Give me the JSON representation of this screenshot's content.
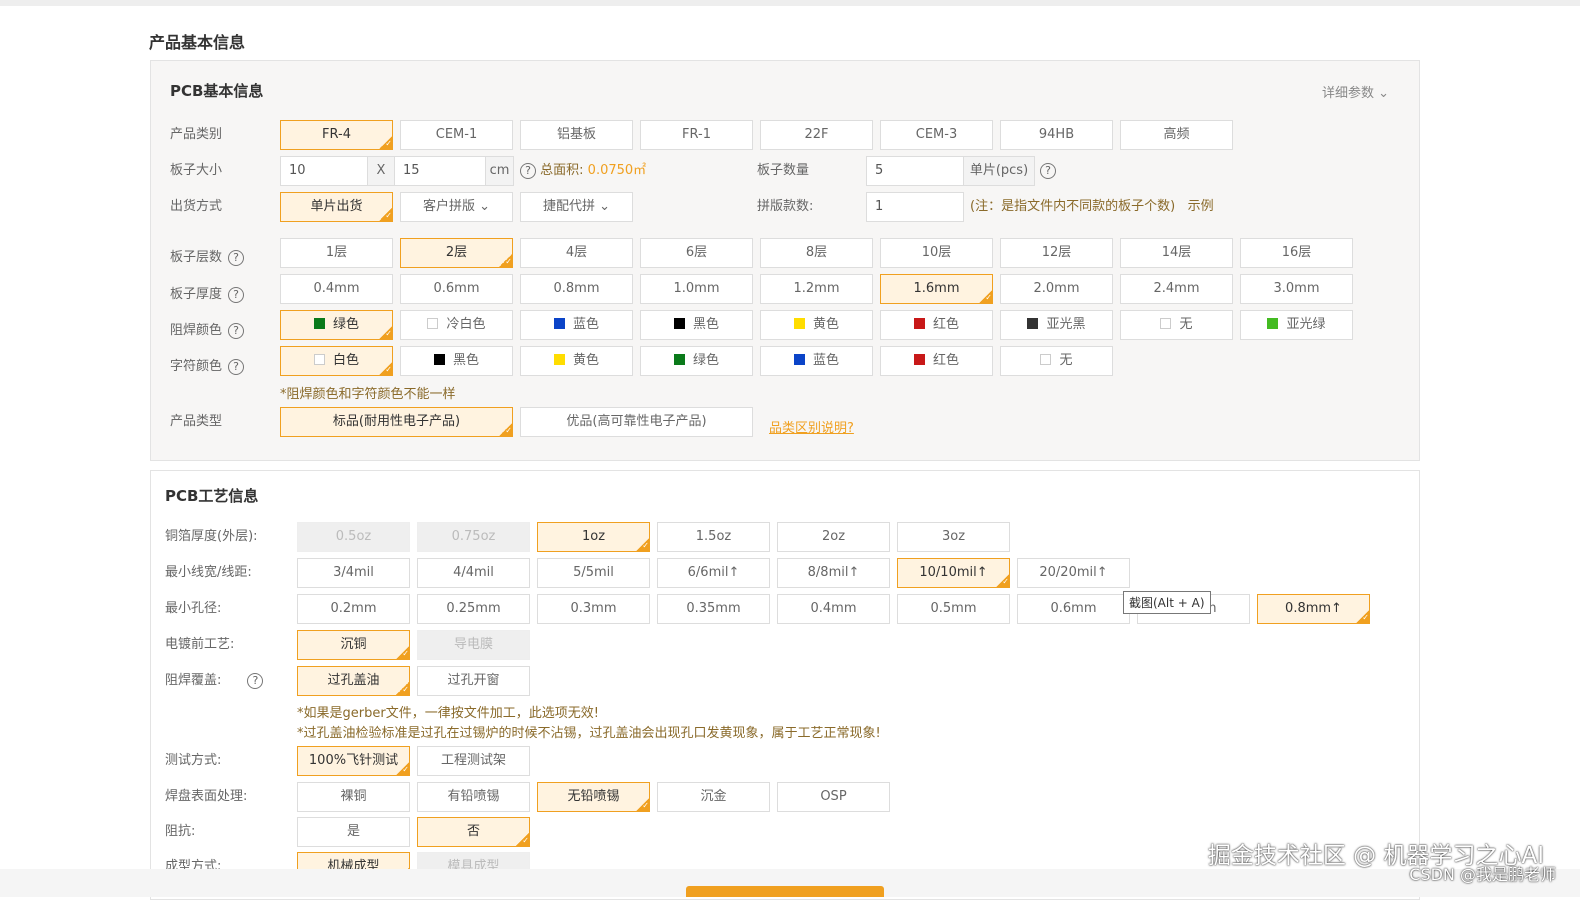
{
  "page_title": "产品基本信息",
  "basic": {
    "title": "PCB基本信息",
    "detail_label": "详细参数",
    "category": {
      "label": "产品类别",
      "options": [
        {
          "label": "FR-4",
          "sel": true
        },
        {
          "label": "CEM-1"
        },
        {
          "label": "铝基板"
        },
        {
          "label": "FR-1"
        },
        {
          "label": "22F"
        },
        {
          "label": "CEM-3"
        },
        {
          "label": "94HB"
        },
        {
          "label": "高频"
        }
      ]
    },
    "size": {
      "label": "板子大小",
      "width": "10",
      "x": "X",
      "height": "15",
      "unit": "cm",
      "area_label": "总面积:",
      "area_value": "0.0750㎡"
    },
    "quantity": {
      "label": "板子数量",
      "value": "5",
      "unit": "单片(pcs)"
    },
    "shipping": {
      "label": "出货方式",
      "options": [
        {
          "label": "单片出货",
          "sel": true
        },
        {
          "label": "客户拼版 ⌄"
        },
        {
          "label": "捷配代拼 ⌄"
        }
      ]
    },
    "panel_count": {
      "label": "拼版款数:",
      "value": "1",
      "note": "(注：是指文件内不同款的板子个数)",
      "example": "示例"
    },
    "layers": {
      "label": "板子层数",
      "options": [
        {
          "label": "1层"
        },
        {
          "label": "2层",
          "sel": true
        },
        {
          "label": "4层"
        },
        {
          "label": "6层"
        },
        {
          "label": "8层"
        },
        {
          "label": "10层"
        },
        {
          "label": "12层"
        },
        {
          "label": "14层"
        },
        {
          "label": "16层"
        }
      ]
    },
    "thickness": {
      "label": "板子厚度",
      "options": [
        {
          "label": "0.4mm"
        },
        {
          "label": "0.6mm"
        },
        {
          "label": "0.8mm"
        },
        {
          "label": "1.0mm"
        },
        {
          "label": "1.2mm"
        },
        {
          "label": "1.6mm",
          "sel": true
        },
        {
          "label": "2.0mm"
        },
        {
          "label": "2.4mm"
        },
        {
          "label": "3.0mm"
        }
      ]
    },
    "mask_color": {
      "label": "阻焊颜色",
      "options": [
        {
          "label": "绿色",
          "sel": true,
          "swatch": "#0a7a1a"
        },
        {
          "label": "冷白色",
          "swatch": "none"
        },
        {
          "label": "蓝色",
          "swatch": "#0b44c8"
        },
        {
          "label": "黑色",
          "swatch": "#000000"
        },
        {
          "label": "黄色",
          "swatch": "#ffdd00"
        },
        {
          "label": "红色",
          "swatch": "#c81818"
        },
        {
          "label": "亚光黑",
          "swatch": "#333333"
        },
        {
          "label": "无",
          "swatch": "none"
        },
        {
          "label": "亚光绿",
          "swatch": "#44bb22"
        }
      ]
    },
    "silk_color": {
      "label": "字符颜色",
      "options": [
        {
          "label": "白色",
          "sel": true,
          "swatch": "none"
        },
        {
          "label": "黑色",
          "swatch": "#000000"
        },
        {
          "label": "黄色",
          "swatch": "#ffdd00"
        },
        {
          "label": "绿色",
          "swatch": "#0a7a1a"
        },
        {
          "label": "蓝色",
          "swatch": "#0b44c8"
        },
        {
          "label": "红色",
          "swatch": "#c81818"
        },
        {
          "label": "无",
          "swatch": "none"
        }
      ]
    },
    "color_note": "*阻焊颜色和字符颜色不能一样",
    "product_type": {
      "label": "产品类型",
      "options": [
        {
          "label": "标品(耐用性电子产品)",
          "sel": true,
          "wide": true
        },
        {
          "label": "优品(高可靠性电子产品)",
          "wide": true
        }
      ],
      "link": "品类区别说明?"
    }
  },
  "process": {
    "title": "PCB工艺信息",
    "copper": {
      "label": "铜箔厚度(外层):",
      "options": [
        {
          "label": "0.5oz",
          "dis": true
        },
        {
          "label": "0.75oz",
          "dis": true
        },
        {
          "label": "1oz",
          "sel": true
        },
        {
          "label": "1.5oz"
        },
        {
          "label": "2oz"
        },
        {
          "label": "3oz"
        }
      ]
    },
    "trace": {
      "label": "最小线宽/线距:",
      "options": [
        {
          "label": "3/4mil"
        },
        {
          "label": "4/4mil"
        },
        {
          "label": "5/5mil"
        },
        {
          "label": "6/6mil↑"
        },
        {
          "label": "8/8mil↑"
        },
        {
          "label": "10/10mil↑",
          "sel": true
        },
        {
          "label": "20/20mil↑"
        }
      ]
    },
    "hole": {
      "label": "最小孔径:",
      "options": [
        {
          "label": "0.2mm"
        },
        {
          "label": "0.25mm"
        },
        {
          "label": "0.3mm"
        },
        {
          "label": "0.35mm"
        },
        {
          "label": "0.4mm"
        },
        {
          "label": "0.5mm"
        },
        {
          "label": "0.6mm"
        },
        {
          "label": "0.7mm"
        },
        {
          "label": "0.8mm↑",
          "sel": true
        }
      ]
    },
    "plating": {
      "label": "电镀前工艺:",
      "options": [
        {
          "label": "沉铜",
          "sel": true
        },
        {
          "label": "导电膜",
          "dis": true
        }
      ]
    },
    "via": {
      "label": "阻焊覆盖:",
      "options": [
        {
          "label": "过孔盖油",
          "sel": true
        },
        {
          "label": "过孔开窗"
        }
      ]
    },
    "via_notes": [
      "*如果是gerber文件，一律按文件加工，此选项无效!",
      "*过孔盖油检验标准是过孔在过锡炉的时候不沾锡，过孔盖油会出现孔口发黄现象，属于工艺正常现象!"
    ],
    "test": {
      "label": "测试方式:",
      "options": [
        {
          "label": "100%飞针测试",
          "sel": true
        },
        {
          "label": "工程测试架"
        }
      ]
    },
    "finish": {
      "label": "焊盘表面处理:",
      "options": [
        {
          "label": "裸铜"
        },
        {
          "label": "有铅喷锡"
        },
        {
          "label": "无铅喷锡",
          "sel": true
        },
        {
          "label": "沉金"
        },
        {
          "label": "OSP"
        }
      ]
    },
    "impedance": {
      "label": "阻抗:",
      "options": [
        {
          "label": "是"
        },
        {
          "label": "否",
          "sel": true
        }
      ]
    },
    "forming": {
      "label": "成型方式:",
      "options": [
        {
          "label": "机械成型",
          "sel": true
        },
        {
          "label": "模具成型",
          "dis": true
        }
      ]
    }
  },
  "tooltip": "截图(Alt + A)",
  "watermark": {
    "line1": "掘金技术社区 @ 机器学习之心AI",
    "line2": "CSDN @我是鹏老师"
  }
}
